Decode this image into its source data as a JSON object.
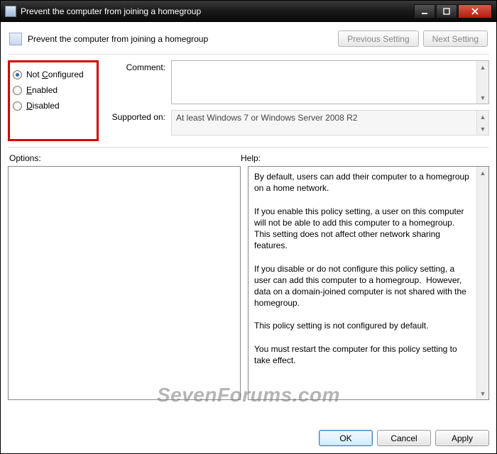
{
  "window": {
    "title": "Prevent the computer from joining a homegroup"
  },
  "header": {
    "title": "Prevent the computer from joining a homegroup",
    "prev_label": "Previous Setting",
    "next_label": "Next Setting"
  },
  "state": {
    "not_configured": "Not Configured",
    "enabled": "Enabled",
    "disabled": "Disabled",
    "selected": "not_configured"
  },
  "fields": {
    "comment_label": "Comment:",
    "comment_value": "",
    "supported_label": "Supported on:",
    "supported_value": "At least Windows 7 or Windows Server 2008 R2"
  },
  "panels": {
    "options_label": "Options:",
    "help_label": "Help:",
    "help_text": "By default, users can add their computer to a homegroup on a home network.\n\nIf you enable this policy setting, a user on this computer will not be able to add this computer to a homegroup.  This setting does not affect other network sharing features.\n\nIf you disable or do not configure this policy setting, a user can add this computer to a homegroup.  However, data on a domain-joined computer is not shared with the homegroup.\n\nThis policy setting is not configured by default.\n\nYou must restart the computer for this policy setting to take effect."
  },
  "buttons": {
    "ok": "OK",
    "cancel": "Cancel",
    "apply": "Apply"
  },
  "watermark": "SevenForums.com"
}
